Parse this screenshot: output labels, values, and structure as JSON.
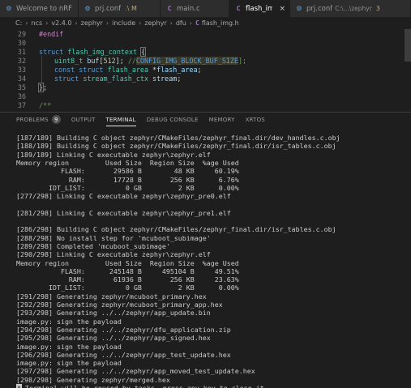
{
  "tabs": [
    {
      "icon": "gear-icon",
      "label": "Welcome to nRF Connect",
      "active": false
    },
    {
      "icon": "gear-icon",
      "label": "prj.conf",
      "suffix": ".\\ M",
      "active": false
    },
    {
      "icon": "c-file-icon",
      "label": "main.c",
      "active": false
    },
    {
      "icon": "c-file-icon",
      "label": "flash_img.h",
      "active": true,
      "close": "×"
    },
    {
      "icon": "gear-icon",
      "label": "prj.conf",
      "path": "C:\\...\\zephyr",
      "count": "3",
      "active": false
    }
  ],
  "breadcrumb": {
    "items": [
      "C:",
      "ncs",
      "v2.4.0",
      "zephyr",
      "include",
      "zephyr",
      "dfu"
    ],
    "file": "flash_img.h",
    "file_icon": "C"
  },
  "editor": {
    "lines": [
      {
        "n": "29",
        "code": "#endif"
      },
      {
        "n": "30",
        "code": ""
      },
      {
        "n": "31",
        "code": "struct flash_img_context {"
      },
      {
        "n": "32",
        "code": "uint8_t buf[512]; //CONFIG_IMG_BLOCK_BUF_SIZE];"
      },
      {
        "n": "33",
        "code": "const struct flash_area *flash_area;"
      },
      {
        "n": "34",
        "code": "struct stream_flash_ctx stream;"
      },
      {
        "n": "35",
        "code": "};"
      },
      {
        "n": "36",
        "code": ""
      },
      {
        "n": "37",
        "code": "/**"
      }
    ]
  },
  "panel": {
    "tabs": [
      {
        "label": "PROBLEMS",
        "badge": "9",
        "active": false
      },
      {
        "label": "OUTPUT",
        "active": false
      },
      {
        "label": "TERMINAL",
        "active": true
      },
      {
        "label": "DEBUG CONSOLE",
        "active": false
      },
      {
        "label": "MEMORY",
        "active": false
      },
      {
        "label": "XRTOS",
        "active": false
      }
    ]
  },
  "terminal": {
    "lines": [
      "[187/189] Building C object zephyr/CMakeFiles/zephyr_final.dir/dev_handles.c.obj",
      "[188/189] Building C object zephyr/CMakeFiles/zephyr_final.dir/isr_tables.c.obj",
      "[189/189] Linking C executable zephyr\\zephyr.elf",
      "Memory region         Used Size  Region Size  %age Used",
      "           FLASH:       29586 B        48 KB     60.19%",
      "             RAM:       17728 B       256 KB      6.76%",
      "        IDT_LIST:          0 GB         2 KB      0.00%",
      "[277/298] Linking C executable zephyr\\zephyr_pre0.elf",
      "",
      "[281/298] Linking C executable zephyr\\zephyr_pre1.elf",
      "",
      "[286/298] Building C object zephyr/CMakeFiles/zephyr_final.dir/isr_tables.c.obj",
      "[288/298] No install step for 'mcuboot_subimage'",
      "[289/298] Completed 'mcuboot_subimage'",
      "[290/298] Linking C executable zephyr\\zephyr.elf",
      "Memory region         Used Size  Region Size  %age Used",
      "           FLASH:      245148 B     495104 B     49.51%",
      "             RAM:       61936 B       256 KB     23.63%",
      "        IDT_LIST:          0 GB         2 KB      0.00%",
      "[291/298] Generating zephyr/mcuboot_primary.hex",
      "[292/298] Generating zephyr/mcuboot_primary_app.hex",
      "[293/298] Generating ../../zephyr/app_update.bin",
      "image.py: sign the payload",
      "[294/298] Generating ../../zephyr/dfu_application.zip",
      "[295/298] Generating ../../zephyr/app_signed.hex",
      "image.py: sign the payload",
      "[296/298] Generating ../../zephyr/app_test_update.hex",
      "image.py: sign the payload",
      "[297/298] Generating ../../zephyr/app_moved_test_update.hex",
      "[298/298] Generating zephyr/merged.hex"
    ],
    "final_marker": "*",
    "final_line": "Terminal will be reused by tasks, press any key to close it."
  },
  "colors": {
    "background": "#1e1e1e",
    "keyword": "#569cd6",
    "type": "#4ec9b0",
    "identifier": "#9cdcfe",
    "number": "#b5cea8",
    "comment": "#6a9955",
    "preprocessor": "#c586c0"
  }
}
